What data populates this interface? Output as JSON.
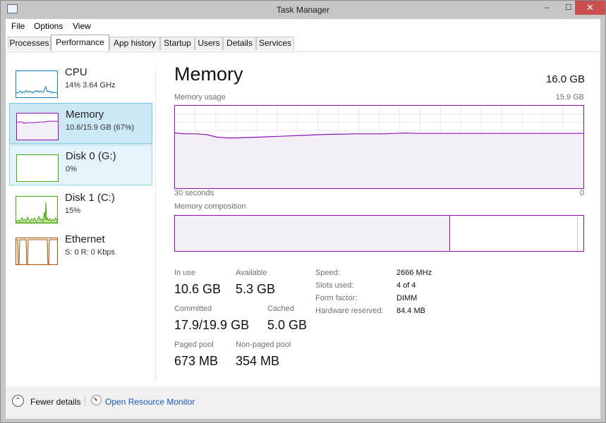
{
  "window": {
    "title": "Task Manager",
    "minimize": "–",
    "maximize": "☐",
    "close": "✕"
  },
  "menu": {
    "file": "File",
    "options": "Options",
    "view": "View"
  },
  "tabs": [
    "Processes",
    "Performance",
    "App history",
    "Startup",
    "Users",
    "Details",
    "Services"
  ],
  "active_tab": "Performance",
  "sidebar": [
    {
      "name": "CPU",
      "detail": "14%  3.64 GHz"
    },
    {
      "name": "Memory",
      "detail": "10.6/15.9 GB (67%)"
    },
    {
      "name": "Disk 0 (G:)",
      "detail": "0%"
    },
    {
      "name": "Disk 1 (C:)",
      "detail": "15%"
    },
    {
      "name": "Ethernet",
      "detail": "S: 0  R: 0 Kbps"
    }
  ],
  "panel": {
    "title": "Memory",
    "total": "16.0 GB",
    "usage_label": "Memory usage",
    "usage_max": "15.9 GB",
    "time_left": "30 seconds",
    "time_right": "0",
    "composition_label": "Memory composition",
    "composition": {
      "in_use_fraction": 0.67,
      "modified_fraction": 0.004,
      "standby_fraction": 0.31,
      "free_fraction": 0.016
    },
    "usage_history_fraction": [
      0.67,
      0.66,
      0.66,
      0.65,
      0.62,
      0.61,
      0.61,
      0.615,
      0.62,
      0.625,
      0.63,
      0.635,
      0.64,
      0.645,
      0.65,
      0.655,
      0.655,
      0.66,
      0.66,
      0.66,
      0.66,
      0.665,
      0.67,
      0.665,
      0.665,
      0.665,
      0.665,
      0.665,
      0.665,
      0.665,
      0.665,
      0.665,
      0.665,
      0.665,
      0.665,
      0.665,
      0.665,
      0.665,
      0.665,
      0.665
    ],
    "stats": {
      "in_use_label": "In use",
      "in_use": "10.6 GB",
      "available_label": "Available",
      "available": "5.3 GB",
      "committed_label": "Committed",
      "committed": "17.9/19.9 GB",
      "cached_label": "Cached",
      "cached": "5.0 GB",
      "paged_label": "Paged pool",
      "paged": "673 MB",
      "nonpaged_label": "Non-paged pool",
      "nonpaged": "354 MB"
    },
    "details": [
      {
        "label": "Speed:",
        "value": "2666 MHz"
      },
      {
        "label": "Slots used:",
        "value": "4 of 4"
      },
      {
        "label": "Form factor:",
        "value": "DIMM"
      },
      {
        "label": "Hardware reserved:",
        "value": "84.4 MB"
      }
    ]
  },
  "footer": {
    "fewer_details": "Fewer details",
    "open_resmon": "Open Resource Monitor"
  },
  "colors": {
    "memory": "#8b12ae",
    "cpu": "#117dbb",
    "disk": "#4da60c",
    "ethernet": "#a74f01",
    "selected_bg": "#cce8f4"
  }
}
